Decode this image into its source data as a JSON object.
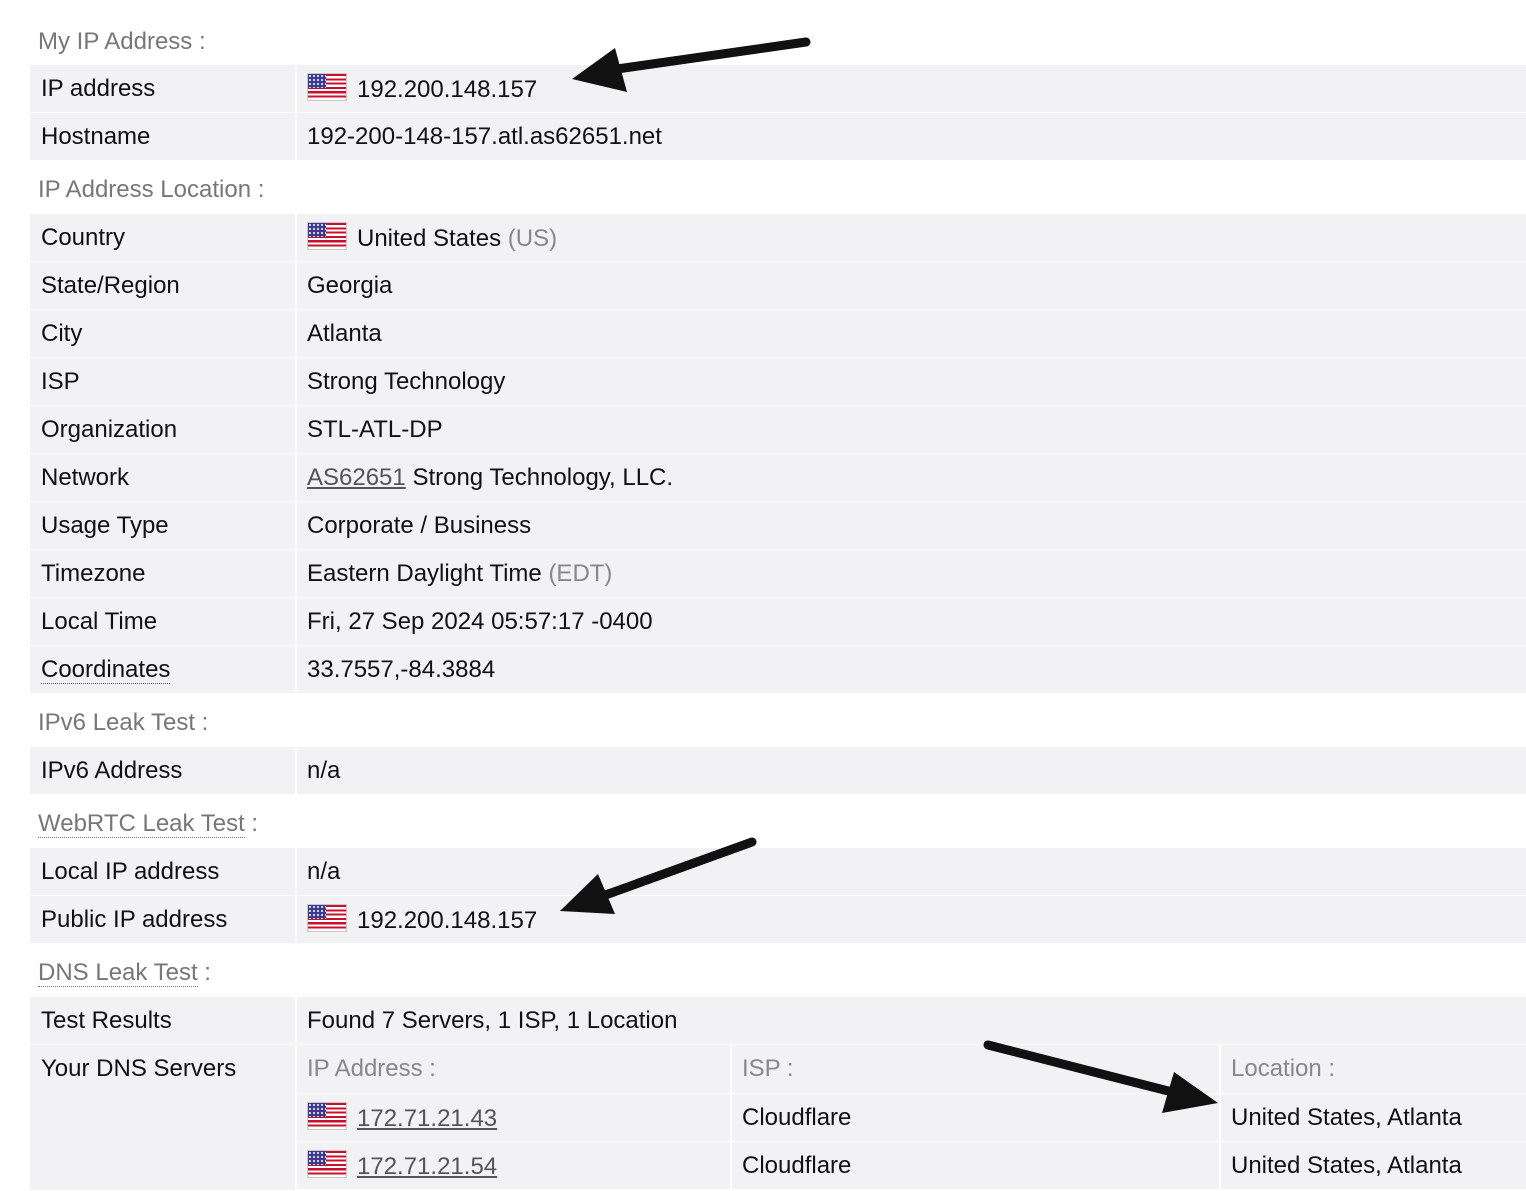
{
  "sections": {
    "my_ip": {
      "title": "My IP Address :",
      "rows": {
        "ip_label": "IP address",
        "ip_value": "192.200.148.157",
        "hostname_label": "Hostname",
        "hostname_value": "192-200-148-157.atl.as62651.net"
      }
    },
    "location": {
      "title": "IP Address Location :",
      "country_label": "Country",
      "country_value": "United States",
      "country_code": "(US)",
      "state_label": "State/Region",
      "state_value": "Georgia",
      "city_label": "City",
      "city_value": "Atlanta",
      "isp_label": "ISP",
      "isp_value": "Strong Technology",
      "org_label": "Organization",
      "org_value": "STL-ATL-DP",
      "network_label": "Network",
      "network_link": "AS62651",
      "network_value": "Strong Technology, LLC.",
      "usage_label": "Usage Type",
      "usage_value": "Corporate / Business",
      "tz_label": "Timezone",
      "tz_value": "Eastern Daylight Time",
      "tz_abbr": "(EDT)",
      "localtime_label": "Local Time",
      "localtime_value": "Fri, 27 Sep 2024 05:57:17 -0400",
      "coords_label": "Coordinates",
      "coords_value": "33.7557,-84.3884"
    },
    "ipv6": {
      "title": "IPv6 Leak Test :",
      "addr_label": "IPv6 Address",
      "addr_value": "n/a"
    },
    "webrtc": {
      "title_link": "WebRTC Leak Test",
      "title_suffix": " :",
      "local_label": "Local IP address",
      "local_value": "n/a",
      "public_label": "Public IP address",
      "public_value": "192.200.148.157"
    },
    "dns": {
      "title_link": "DNS Leak Test",
      "title_suffix": " :",
      "results_label": "Test Results",
      "results_value": "Found 7 Servers, 1 ISP, 1 Location",
      "servers_label": "Your DNS Servers",
      "col_ip": "IP Address :",
      "col_isp": "ISP :",
      "col_location": "Location :",
      "servers": [
        {
          "ip": "172.71.21.43",
          "isp": "Cloudflare",
          "location": "United States, Atlanta"
        },
        {
          "ip": "172.71.21.54",
          "isp": "Cloudflare",
          "location": "United States, Atlanta"
        }
      ]
    }
  },
  "flag_icon": "us-flag-icon",
  "colors": {
    "row_bg": "#f2f2f4",
    "muted": "#777777",
    "arrow": "#111111"
  }
}
